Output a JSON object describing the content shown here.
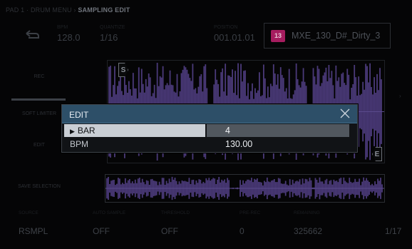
{
  "breadcrumb": {
    "path": "PAD 1 · DRUM MENU › ",
    "current": "SAMPLING EDIT"
  },
  "header": {
    "bpm_label": "BPM",
    "bpm": "128.0",
    "quantize_label": "QUANTIZE",
    "quantize": "1/16",
    "position_label": "POSITION",
    "position": "001.01.01",
    "pad_number": "13",
    "sample_name": "MXE_130_D#_Dirty_3"
  },
  "sidebar": {
    "rec": "REC",
    "soft_limiter": "SOFT LIMITER",
    "edit": "EDIT",
    "save_selection": "SAVE SELECTION"
  },
  "waveform": {
    "start_marker": "S",
    "end_marker": "E",
    "color": "#4b3a7a"
  },
  "bottom": [
    {
      "label": "SOURCE",
      "value": "RSMPL"
    },
    {
      "label": "AUTO SAMPLE",
      "value": "OFF"
    },
    {
      "label": "THRESHOLD",
      "value": "OFF"
    },
    {
      "label": "PRE-REC",
      "value": "0"
    },
    {
      "label": "REMAINING",
      "value": "325662"
    },
    {
      "label": "",
      "value": "1/17"
    }
  ],
  "dialog": {
    "title": "EDIT",
    "rows": [
      {
        "label": "BAR",
        "value": "4",
        "selected": true
      },
      {
        "label": "BPM",
        "value": "130.00",
        "selected": false
      }
    ]
  },
  "colors": {
    "dialog_header": "#2d4f68",
    "pad_badge": "#a61d5f",
    "selected_row": "#c9ced4"
  }
}
